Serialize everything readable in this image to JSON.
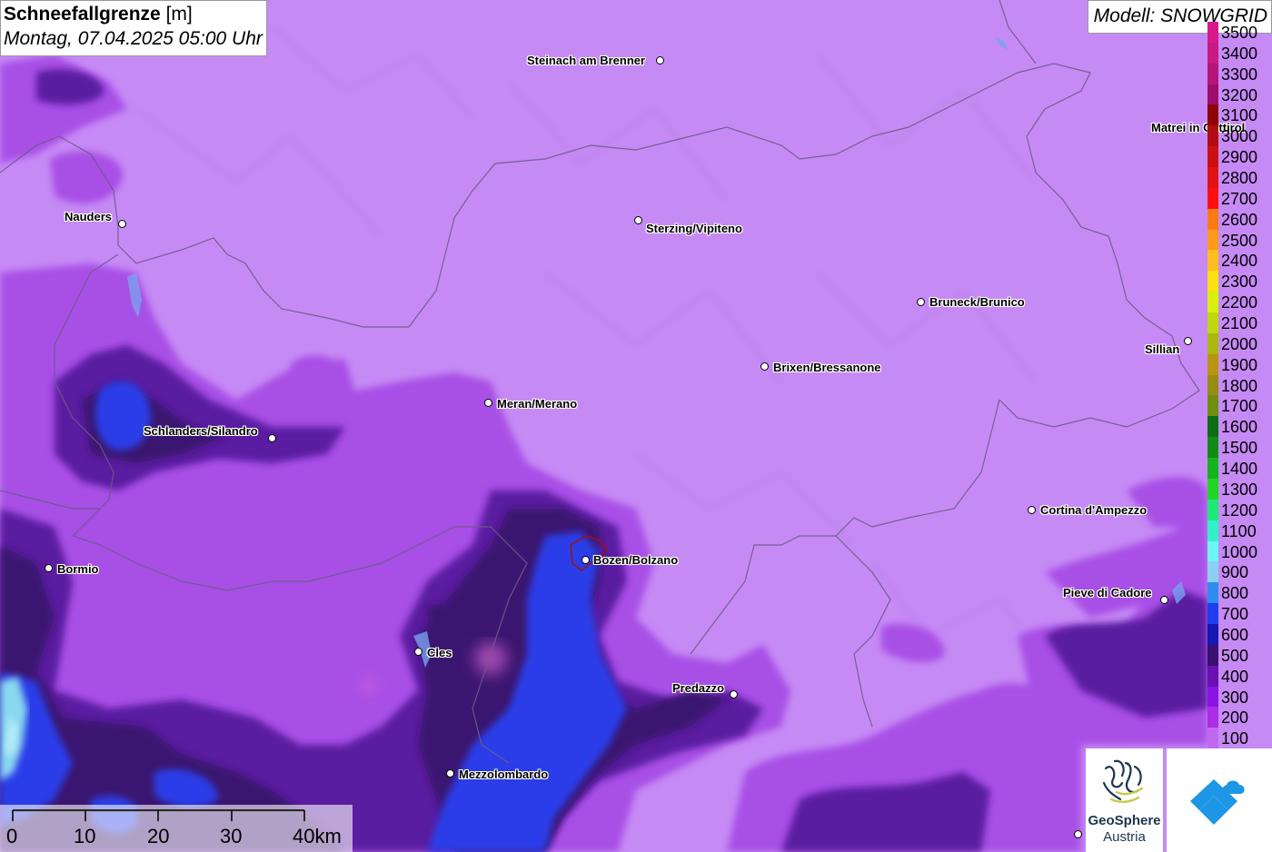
{
  "title": {
    "parameter": "Schneefallgrenze",
    "unit": "[m]",
    "datetime": "Montag, 07.04.2025 05:00 Uhr"
  },
  "model_label": "Modell: SNOWGRID",
  "legend": [
    {
      "label": "3500",
      "color": "#d8198c"
    },
    {
      "label": "3400",
      "color": "#c91a83"
    },
    {
      "label": "3300",
      "color": "#b5157a"
    },
    {
      "label": "3200",
      "color": "#9b0e6c"
    },
    {
      "label": "3100",
      "color": "#8e0508"
    },
    {
      "label": "3000",
      "color": "#b30b0f"
    },
    {
      "label": "2900",
      "color": "#cc1010"
    },
    {
      "label": "2800",
      "color": "#e31313"
    },
    {
      "label": "2700",
      "color": "#ff1010"
    },
    {
      "label": "2600",
      "color": "#ff7a12"
    },
    {
      "label": "2500",
      "color": "#ff9a1a"
    },
    {
      "label": "2400",
      "color": "#ffbe1f"
    },
    {
      "label": "2300",
      "color": "#ffe012"
    },
    {
      "label": "2200",
      "color": "#d8ef10"
    },
    {
      "label": "2100",
      "color": "#bed70e"
    },
    {
      "label": "2000",
      "color": "#a8b80c"
    },
    {
      "label": "1900",
      "color": "#b89410"
    },
    {
      "label": "1800",
      "color": "#968c12"
    },
    {
      "label": "1700",
      "color": "#6f8e10"
    },
    {
      "label": "1600",
      "color": "#0d6d12"
    },
    {
      "label": "1500",
      "color": "#0f8c16"
    },
    {
      "label": "1400",
      "color": "#16b31e"
    },
    {
      "label": "1300",
      "color": "#24d424"
    },
    {
      "label": "1200",
      "color": "#1fe87b"
    },
    {
      "label": "1100",
      "color": "#32f0c8"
    },
    {
      "label": "1000",
      "color": "#6ef5f5"
    },
    {
      "label": "900",
      "color": "#8ccff5"
    },
    {
      "label": "800",
      "color": "#2d8cf0"
    },
    {
      "label": "700",
      "color": "#1e3ef0"
    },
    {
      "label": "600",
      "color": "#1418b4"
    },
    {
      "label": "500",
      "color": "#3a1070"
    },
    {
      "label": "400",
      "color": "#6a0fb4"
    },
    {
      "label": "300",
      "color": "#8a14e6"
    },
    {
      "label": "200",
      "color": "#aa2ce6"
    },
    {
      "label": "100",
      "color": "#c068f0"
    }
  ],
  "cities": [
    {
      "name": "Steinach am Brenner",
      "id": "steinach"
    },
    {
      "name": "Nauders",
      "id": "nauders"
    },
    {
      "name": "Sterzing/Vipiteno",
      "id": "sterzing"
    },
    {
      "name": "Matrei in Osttirol",
      "id": "matrei"
    },
    {
      "name": "Bruneck/Brunico",
      "id": "bruneck"
    },
    {
      "name": "Sillian",
      "id": "sillian"
    },
    {
      "name": "Brixen/Bressanone",
      "id": "brixen"
    },
    {
      "name": "Meran/Merano",
      "id": "meran"
    },
    {
      "name": "Schlanders/Silandro",
      "id": "schlanders"
    },
    {
      "name": "Cortina d'Ampezzo",
      "id": "cortina"
    },
    {
      "name": "Bormio",
      "id": "bormio"
    },
    {
      "name": "Bozen/Bolzano",
      "id": "bozen"
    },
    {
      "name": "Pieve di Cadore",
      "id": "pieve"
    },
    {
      "name": "Cles",
      "id": "cles"
    },
    {
      "name": "Predazzo",
      "id": "predazzo"
    },
    {
      "name": "Mezzolombardo",
      "id": "mezzolombardo"
    }
  ],
  "scale_bar": {
    "labels": [
      "0",
      "10",
      "20",
      "30",
      "40km"
    ]
  },
  "logos": {
    "geosphere_name": "GeoSphere",
    "geosphere_sub": "Austria"
  },
  "colors": {
    "background": "#c68af5",
    "low_violet": "#a84fe6",
    "dark_purple": "#4a1a8c",
    "blue": "#2a3ce8",
    "cyan": "#8ad8f0",
    "border": "#6e5a8a"
  }
}
